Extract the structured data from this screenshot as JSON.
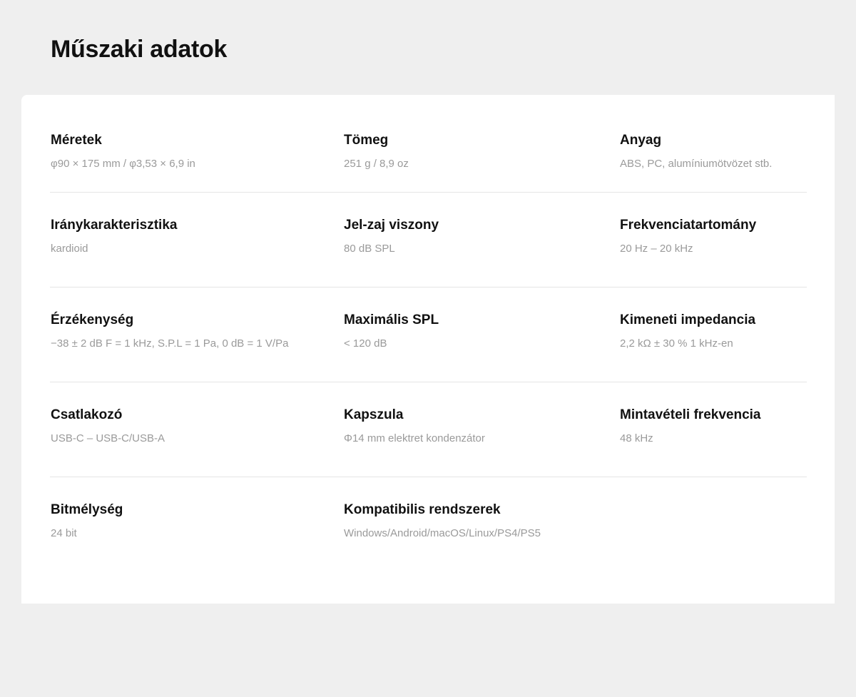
{
  "page": {
    "title": "Műszaki adatok"
  },
  "specs": [
    [
      {
        "label": "Méretek",
        "value": "φ90 × 175 mm / φ3,53 × 6,9 in"
      },
      {
        "label": "Tömeg",
        "value": "251 g / 8,9 oz"
      },
      {
        "label": "Anyag",
        "value": "ABS, PC, alumíniumötvözet stb."
      }
    ],
    [
      {
        "label": "Iránykarakterisztika",
        "value": "kardioid"
      },
      {
        "label": "Jel-zaj viszony",
        "value": "80 dB SPL"
      },
      {
        "label": "Frekvenciatartomány",
        "value": "20 Hz – 20 kHz"
      }
    ],
    [
      {
        "label": "Érzékenység",
        "value": "−38 ± 2 dB F = 1 kHz, S.P.L = 1 Pa, 0 dB = 1 V/Pa"
      },
      {
        "label": "Maximális SPL",
        "value": "< 120 dB"
      },
      {
        "label": "Kimeneti impedancia",
        "value": "2,2 kΩ ± 30 % 1 kHz-en"
      }
    ],
    [
      {
        "label": "Csatlakozó",
        "value": "USB-C – USB-C/USB-A"
      },
      {
        "label": "Kapszula",
        "value": "Φ14 mm elektret kondenzátor"
      },
      {
        "label": "Mintavételi frekvencia",
        "value": "48 kHz"
      }
    ],
    [
      {
        "label": "Bitmélység",
        "value": "24 bit"
      },
      {
        "label": "Kompatibilis rendszerek",
        "value": "Windows/Android/macOS/Linux/PS4/PS5"
      }
    ]
  ]
}
